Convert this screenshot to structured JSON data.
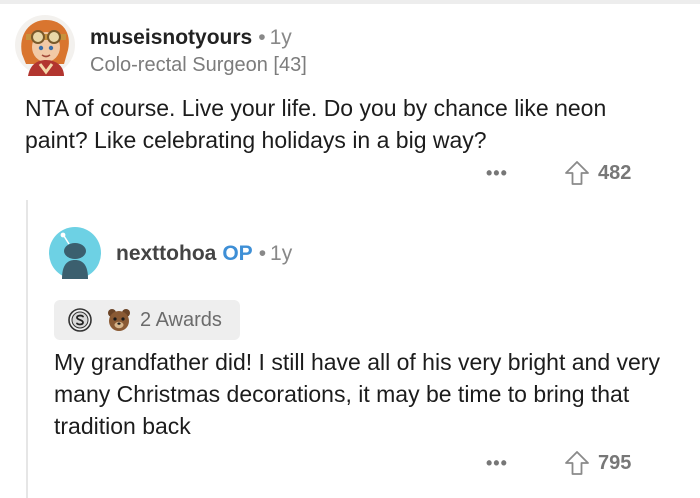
{
  "comment": {
    "username": "museisnotyours",
    "age": "1y",
    "separator": "•",
    "flair": "Colo-rectal Surgeon [43]",
    "body": "NTA of course. Live your life. Do you by chance like neon paint? Like celebrating holidays in a big way?",
    "more_label": "•••",
    "score": "482",
    "avatar_icon": "avatar-redhead-goggles-icon",
    "upvote_icon": "upvote-arrow-icon"
  },
  "reply": {
    "username": "nexttohoa",
    "op_badge": "OP",
    "age": "1y",
    "separator": "•",
    "awards_label": "2 Awards",
    "award_icons": [
      "silver-s-award-icon",
      "bear-award-icon"
    ],
    "body": "My grandfather did! I still have all of his very bright and very many Christmas decorations, it may be time to bring that tradition back",
    "more_label": "•••",
    "score": "795",
    "avatar_icon": "default-snoo-avatar-icon",
    "upvote_icon": "upvote-arrow-icon"
  },
  "colors": {
    "op_badge": "#3e8fd6",
    "meta_text": "#888888",
    "avatar_bg": "#6dd1e4",
    "awards_bg": "#eeeeee"
  }
}
